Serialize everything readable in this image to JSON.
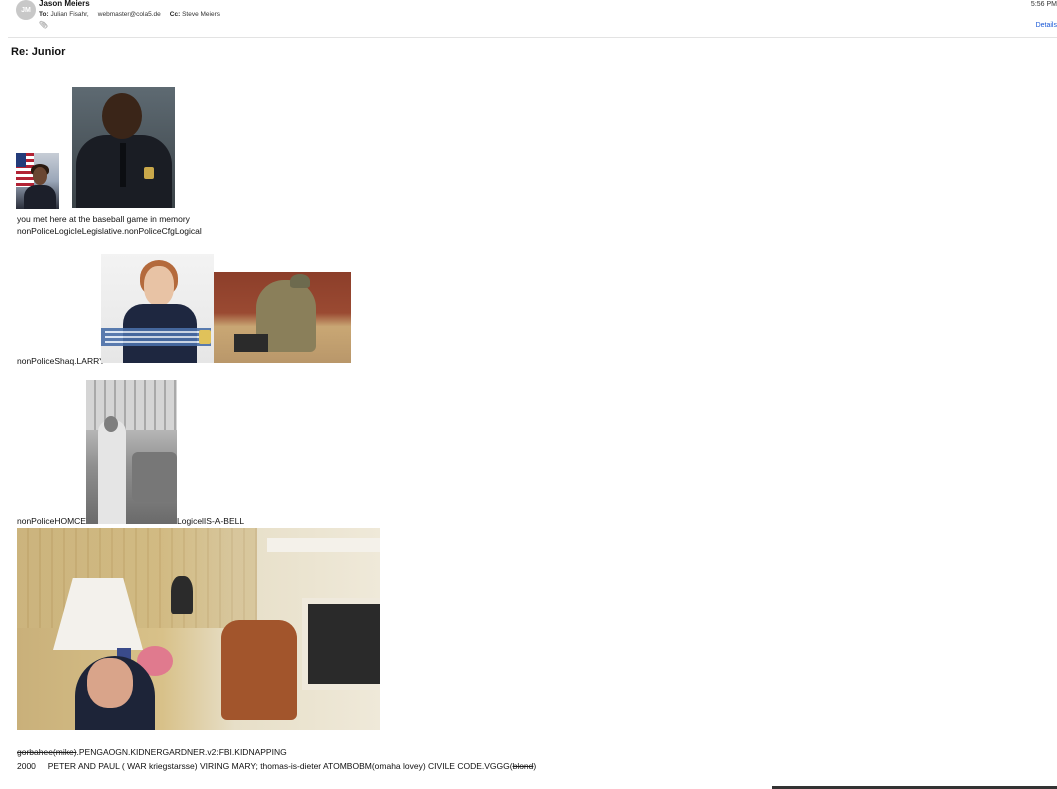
{
  "header": {
    "avatar_initials": "JM",
    "sender": "Jason Meiers",
    "to_label": "To:",
    "to_1": "Julian Fisahr,",
    "to_2": "webmaster@cola5.de",
    "cc_label": "Cc:",
    "cc_1": "Steve Meiers",
    "time": "5:56 PM",
    "details_label": "Details",
    "attachment_icon": "paperclip-icon"
  },
  "subject": "Re: Junior",
  "body": {
    "line1": "you met here at the baseball game in memory",
    "line2": "nonPoliceLogicIeLegislative.nonPoliceCfgLogical",
    "line3": "nonPoliceShaq.LARRY",
    "line4a": "nonPoliceHOMCE",
    "line4b": "LogicelIS-A-BELL",
    "line5_strike": "gorbahee(mike)",
    "line5_rest": ".PENGAOGN.KIDNERGARDNER.v2:FBI.KIDNAPPING",
    "line6_year": "2000",
    "line6_text": "PETER AND PAUL ( WAR kriegstarsse)  VIRING MARY; thomas-is-dieter ATOMBOBM(omaha lovey) CIVILE CODE.VGGG(",
    "line6_strike": "blond",
    "line6_end": ")"
  }
}
